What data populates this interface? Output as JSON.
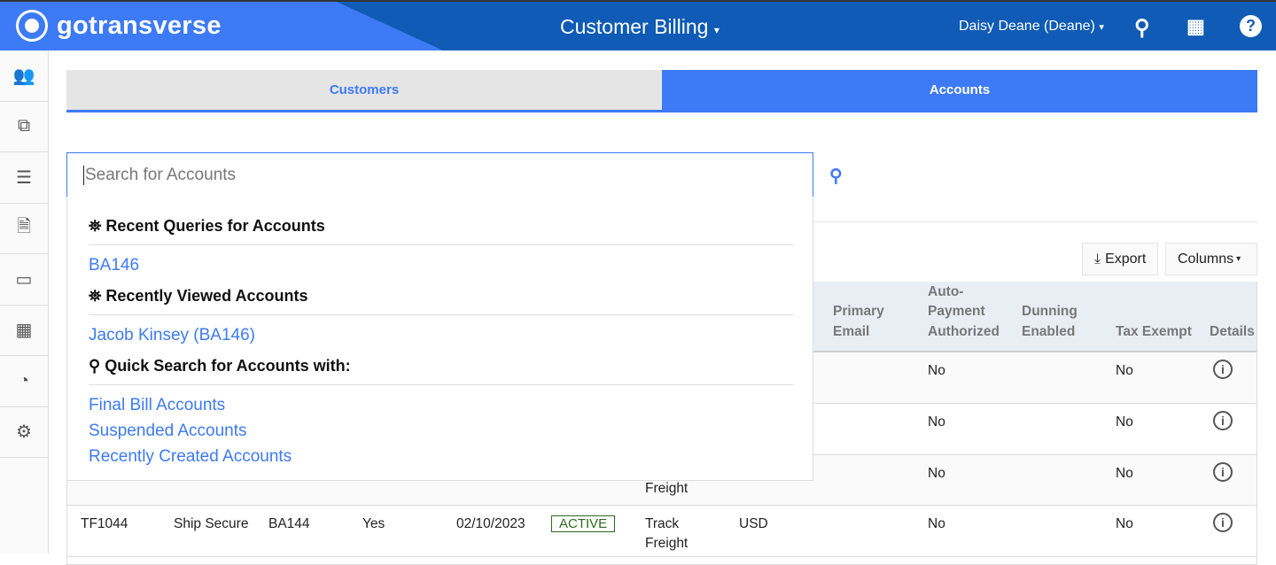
{
  "header": {
    "brand": "gotransverse",
    "app_title": "Customer Billing",
    "user": "Daisy Deane (Deane)"
  },
  "sidebar": {
    "items": [
      {
        "icon": "users-icon",
        "glyph": "👥"
      },
      {
        "icon": "copy-icon",
        "glyph": "⧉"
      },
      {
        "icon": "server-icon",
        "glyph": "☰"
      },
      {
        "icon": "document-icon",
        "glyph": "🗎"
      },
      {
        "icon": "credit-card-icon",
        "glyph": "▭"
      },
      {
        "icon": "calculator-icon",
        "glyph": "▦"
      },
      {
        "icon": "dashboard-icon",
        "glyph": "◔"
      },
      {
        "icon": "gear-icon",
        "glyph": "⚙"
      }
    ]
  },
  "tabs": {
    "customers": "Customers",
    "accounts": "Accounts"
  },
  "search": {
    "placeholder": "Search for Accounts"
  },
  "dropdown": {
    "recent_queries_title": "Recent Queries for Accounts",
    "recent_queries": [
      "BA146"
    ],
    "recently_viewed_title": "Recently Viewed Accounts",
    "recently_viewed": [
      "Jacob Kinsey (BA146)"
    ],
    "quick_search_title": "Quick Search for Accounts with:",
    "quick_search": [
      "Final Bill Accounts",
      "Suspended Accounts",
      "Recently Created Accounts"
    ]
  },
  "toolbar": {
    "export": "Export",
    "columns": "Columns"
  },
  "table": {
    "headers": {
      "primary_email": [
        "Primary",
        "Email"
      ],
      "auto_payment": [
        "Auto-",
        "Payment",
        "Authorized"
      ],
      "dunning": [
        "Dunning",
        "Enabled"
      ],
      "tax_exempt": "Tax Exempt",
      "details": "Details"
    },
    "rows": [
      {
        "auto_payment": "No",
        "tax_exempt": "No"
      },
      {
        "auto_payment": "No",
        "tax_exempt": "No"
      },
      {
        "bill_cycle_tail": "Freight",
        "auto_payment": "No",
        "tax_exempt": "No"
      },
      {
        "id": "TF1044",
        "name": "Ship Secure",
        "account": "BA144",
        "flag": "Yes",
        "date": "02/10/2023",
        "status": "ACTIVE",
        "bill_cycle": [
          "Track",
          "Freight"
        ],
        "currency": "USD",
        "auto_payment": "No",
        "tax_exempt": "No"
      }
    ]
  }
}
